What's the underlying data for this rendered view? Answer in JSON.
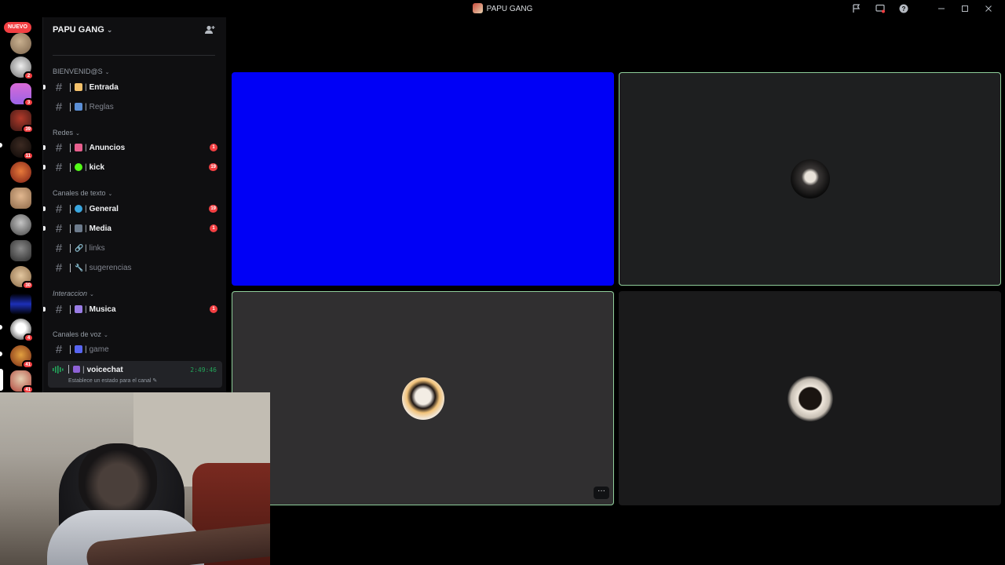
{
  "window": {
    "title": "PAPU GANG",
    "controls": [
      "inbox-icon",
      "screen-share-icon",
      "help-icon",
      "minimize-icon",
      "maximize-icon",
      "close-icon"
    ]
  },
  "rail": {
    "new_label": "NUEVO",
    "servers": [
      {
        "badge": ""
      },
      {
        "badge": "2"
      },
      {
        "badge": "3"
      },
      {
        "badge": "39"
      },
      {
        "badge": "11"
      },
      {
        "badge": ""
      },
      {
        "badge": ""
      },
      {
        "badge": ""
      },
      {
        "badge": ""
      },
      {
        "badge": "30"
      },
      {
        "badge": ""
      },
      {
        "badge": "4"
      },
      {
        "badge": "41"
      },
      {
        "badge": "41"
      }
    ]
  },
  "sidebar": {
    "server_name": "PAPU GANG",
    "categories": {
      "bienvenidos": "BIENVENID@S",
      "redes": "Redes",
      "texto": "Canales de texto",
      "interaccion": "Interaccion",
      "voz": "Canales de voz"
    },
    "channels": {
      "entrada": {
        "name": "Entrada",
        "emoji_color": "#f5c26b"
      },
      "reglas": {
        "name": "Reglas",
        "emoji_color": "#5b8fd6"
      },
      "anuncios": {
        "name": "Anuncios",
        "emoji_color": "#e85f8e",
        "badge": "1"
      },
      "kick": {
        "name": "kick",
        "emoji_color": "#53fc18",
        "badge": "19"
      },
      "general": {
        "name": "General",
        "emoji_color": "#3aa7e0",
        "badge": "19"
      },
      "media": {
        "name": "Media",
        "emoji_color": "#6d7b8c",
        "badge": "1"
      },
      "links": {
        "name": "links",
        "emoji_color": "#b5bac1"
      },
      "sugerencias": {
        "name": "sugerencias",
        "emoji_color": "#c9c9c9"
      },
      "musica": {
        "name": "Musica",
        "emoji_color": "#9a7de6",
        "badge": "1"
      },
      "game": {
        "name": "game",
        "emoji_color": "#5865f2"
      }
    },
    "voice": {
      "name": "voicechat",
      "time": "2:49:46",
      "status": "Establece un estado para el canal"
    }
  },
  "stage": {
    "tiles": [
      {
        "id": "screen",
        "color": "#0000f6"
      },
      {
        "id": "user-1",
        "color": "#1e1f20"
      },
      {
        "id": "user-2",
        "color": "#302f30"
      },
      {
        "id": "user-3",
        "color": "#1a1a1b"
      }
    ],
    "more_label": "···"
  },
  "colors": {
    "accent_green": "#23a55a",
    "badge_red": "#f23f42",
    "speaking_outline": "#8fce9a"
  }
}
